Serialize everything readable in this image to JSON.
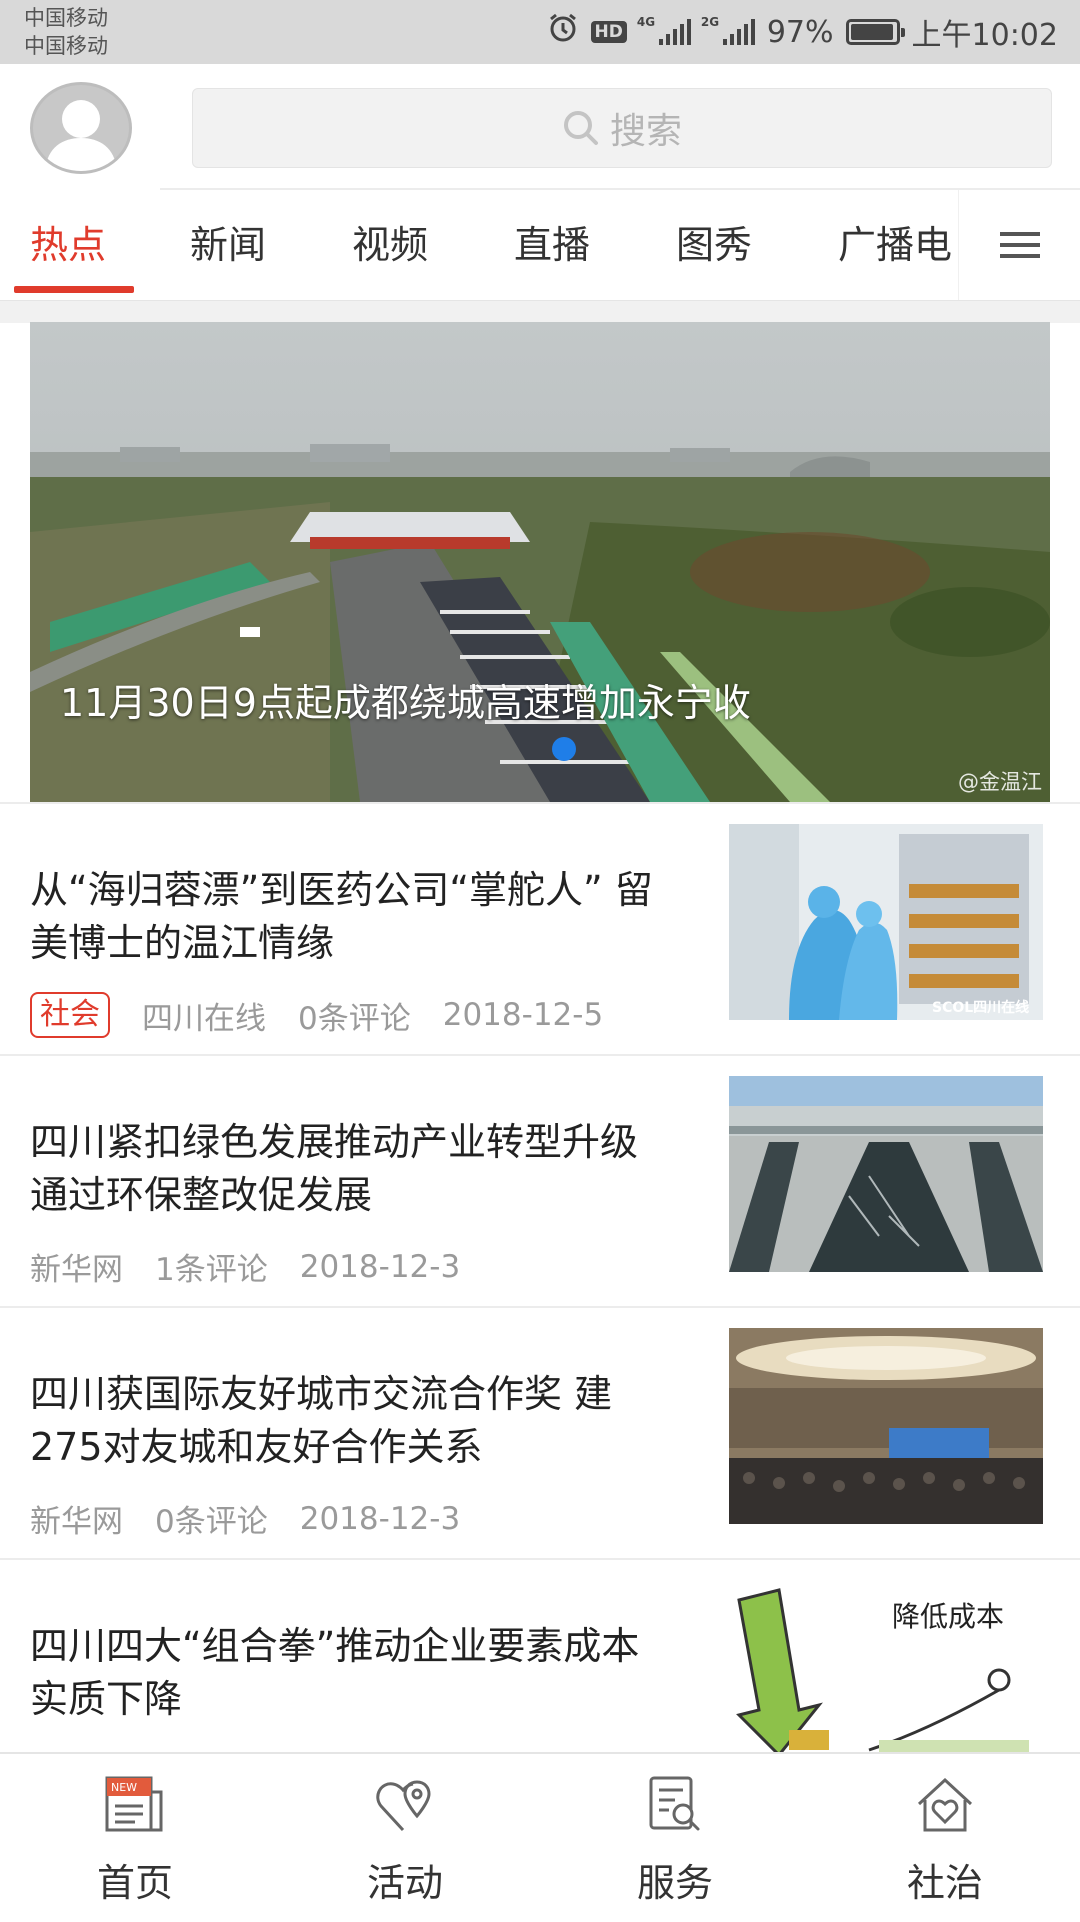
{
  "status_bar": {
    "carrier_1": "中国移动",
    "carrier_2": "中国移动",
    "hd": "HD",
    "net_1": "4G",
    "net_2": "2G",
    "battery_pct_text": "97%",
    "battery_level": 0.97,
    "time": "上午10:02"
  },
  "header": {
    "search_placeholder": "搜索"
  },
  "tabs": [
    {
      "label": "热点",
      "active": true
    },
    {
      "label": "新闻",
      "active": false
    },
    {
      "label": "视频",
      "active": false
    },
    {
      "label": "直播",
      "active": false
    },
    {
      "label": "图秀",
      "active": false
    },
    {
      "label": "广播电",
      "active": false
    }
  ],
  "banner": {
    "title": "11月30日9点起成都绕城高速增加永宁收",
    "watermark": "@金温江"
  },
  "news": [
    {
      "title": "从“海归蓉漂”到医药公司“掌舵人” 留美博士的温江情缘",
      "tag": "社会",
      "source": "四川在线",
      "comments": "0条评论",
      "date": "2018-12-5",
      "thumb_watermark": "SCOL四川在线"
    },
    {
      "title": "四川紧扣绿色发展推动产业转型升级 通过环保整改促发展",
      "source": "新华网",
      "comments": "1条评论",
      "date": "2018-12-3"
    },
    {
      "title": "四川获国际友好城市交流合作奖 建275对友城和友好合作关系",
      "source": "新华网",
      "comments": "0条评论",
      "date": "2018-12-3"
    },
    {
      "title": "四川四大“组合拳”推动企业要素成本实质下降",
      "thumb_caption": "降低成本"
    }
  ],
  "bottom_nav": [
    {
      "label": "首页",
      "icon": "newspaper-icon",
      "badge": "NEW"
    },
    {
      "label": "活动",
      "icon": "heart-location-icon"
    },
    {
      "label": "服务",
      "icon": "search-document-icon"
    },
    {
      "label": "社治",
      "icon": "home-heart-icon"
    }
  ],
  "colors": {
    "accent": "#e03b2c",
    "status_bar_bg": "#d9d9d9",
    "indicator_dot": "#1f7ee8"
  }
}
